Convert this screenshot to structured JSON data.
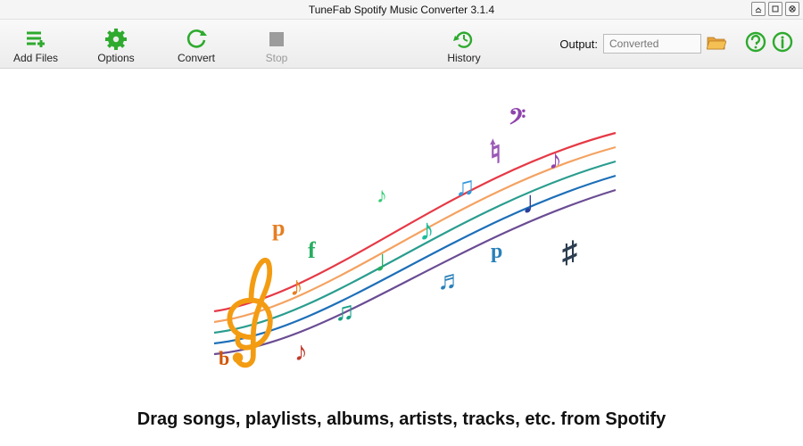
{
  "window": {
    "title": "TuneFab Spotify Music Converter 3.1.4"
  },
  "toolbar": {
    "add_files": "Add Files",
    "options": "Options",
    "convert": "Convert",
    "stop": "Stop",
    "history": "History",
    "output_label": "Output:",
    "output_placeholder": "Converted"
  },
  "main": {
    "drop_hint": "Drag songs, playlists, albums, artists, tracks, etc. from Spotify"
  },
  "colors": {
    "accent": "#2eaa2e"
  }
}
